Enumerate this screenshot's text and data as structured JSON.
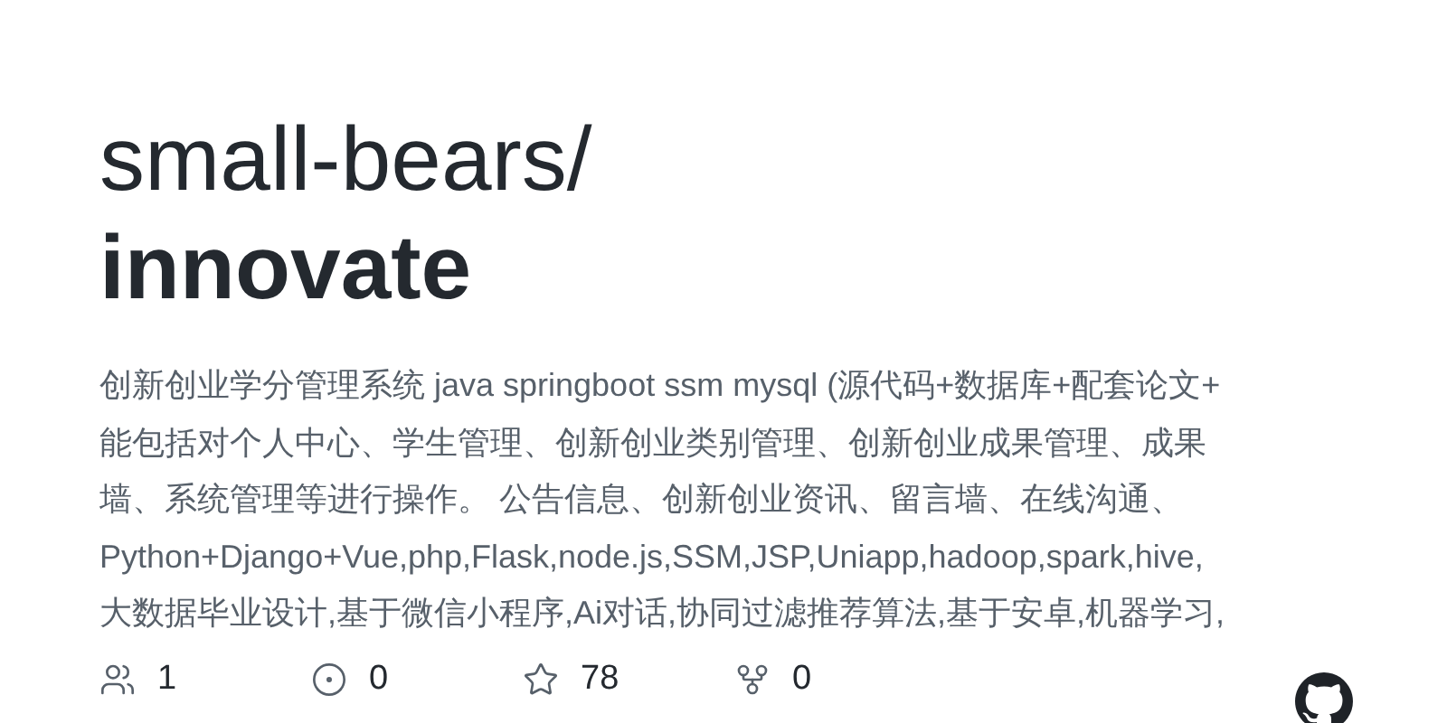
{
  "repo": {
    "owner": "small-bears/",
    "name": "innovate"
  },
  "description_lines": [
    "创新创业学分管理系统 java springboot ssm mysql (源代码+数据库+配套论文+",
    "能包括对个人中心、学生管理、创新创业类别管理、创新创业成果管理、成果",
    "墙、系统管理等进行操作。 公告信息、创新创业资讯、留言墙、在线沟通、",
    "Python+Django+Vue,php,Flask,node.js,SSM,JSP,Uniapp,hadoop,spark,hive,",
    "大数据毕业设计,基于微信小程序,Ai对话,协同过滤推荐算法,基于安卓,机器学习,"
  ],
  "stats": [
    {
      "kind": "contributors",
      "value": "1"
    },
    {
      "kind": "issues",
      "value": "0"
    },
    {
      "kind": "stars",
      "value": "78"
    },
    {
      "kind": "forks",
      "value": "0"
    }
  ]
}
